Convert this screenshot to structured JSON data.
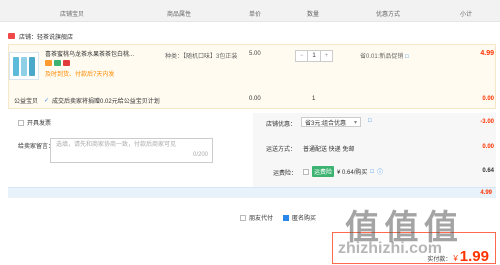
{
  "header": {
    "col_shop": "店铺宝贝",
    "col_attr": "商品属性",
    "col_price": "单价",
    "col_qty": "数量",
    "col_discount": "优惠方式",
    "col_subtotal": "小计"
  },
  "shop": {
    "label": "店铺：轻茶说旗舰店"
  },
  "item": {
    "title": "喜茶蜜桃乌龙茶水果茶茶包白桃...",
    "spec": "种类：【随机口味】3包正装",
    "promo": "及时到货、付款后7天内发",
    "price": "5.00",
    "qty": "1",
    "qty_minus": "−",
    "qty_plus": "+",
    "discount": "省0.01:新品促销",
    "subtotal": "4.99"
  },
  "charity": {
    "label": "公益宝贝",
    "desc": "成交后卖家将捐赠0.02元给公益宝贝计划",
    "price": "0.00",
    "qty": "1",
    "amount": "0.00"
  },
  "invoice": {
    "label": "开具发票"
  },
  "message": {
    "label": "给卖家留言：",
    "placeholder": "选填，请先和商家协商一致，付款后商家可见",
    "counter": "0/200"
  },
  "shop_discount": {
    "label": "店铺优惠：",
    "value": "省3元:组合优惠",
    "amount": "-3.00"
  },
  "shipping": {
    "label": "运送方式：",
    "value": "普通配送 快递 免邮",
    "amount": "0.00"
  },
  "insurance": {
    "label": "运费险：",
    "tag": "运费险",
    "value": "¥ 0.64/购买",
    "amount": "0.64"
  },
  "total_bar": {
    "amount": "4.99"
  },
  "actions": {
    "friend_pay": "朋友代付",
    "anon": "匿名购买"
  },
  "pay": {
    "label": "实付款：",
    "currency": "¥",
    "amount": "1.99"
  },
  "watermark": {
    "text": "值 值 值",
    "url": "zhizhizhi.com"
  },
  "colors": {
    "accent": "#ff3300",
    "blue": "#2a86e8",
    "promo": "#ff8a00"
  }
}
